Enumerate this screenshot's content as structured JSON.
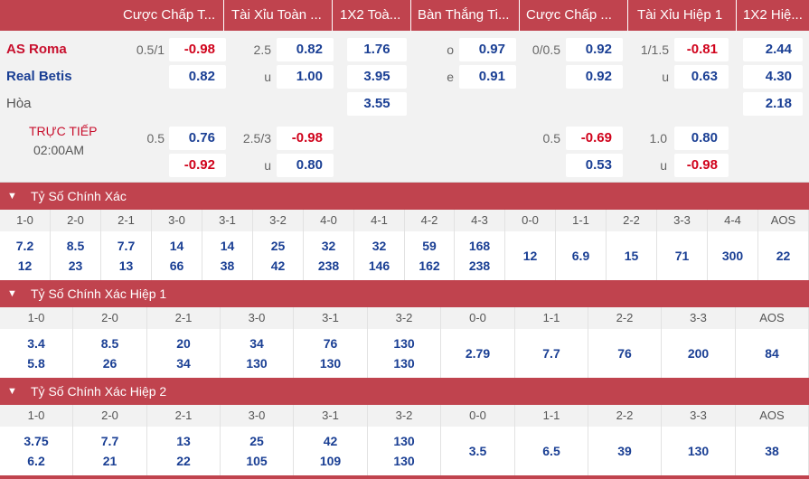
{
  "header": {
    "columns": [
      "Cược Chấp T...",
      "Tài Xỉu Toàn ...",
      "1X2 Toà...",
      "Bàn Thắng Ti...",
      "Cược Chấp ...",
      "Tài Xỉu Hiệp 1",
      "1X2 Hiệ..."
    ]
  },
  "match": {
    "home": "AS Roma",
    "away": "Real Betis",
    "draw": "Hòa",
    "live": "TRỰC TIẾP",
    "time": "02:00AM",
    "r1": {
      "hdp": "0.5/1",
      "hdp_odds": "-0.98",
      "ou_line": "2.5",
      "ou_odds": "0.82",
      "x12": "1.76",
      "goal_lbl": "o",
      "goal_odds": "0.97",
      "h1_hdp": "0/0.5",
      "h1_hdp_odds": "0.92",
      "h1_ou": "1/1.5",
      "h1_ou_odds": "-0.81",
      "h1_x12": "2.44"
    },
    "r2": {
      "hdp_odds": "0.82",
      "ou_lbl": "u",
      "ou_odds": "1.00",
      "x12": "3.95",
      "goal_lbl": "e",
      "goal_odds": "0.91",
      "h1_hdp_odds": "0.92",
      "h1_ou_lbl": "u",
      "h1_ou_odds": "0.63",
      "h1_x12": "4.30"
    },
    "r3": {
      "x12": "3.55",
      "h1_x12": "2.18"
    },
    "r4": {
      "hdp": "0.5",
      "hdp_odds": "0.76",
      "ou_line": "2.5/3",
      "ou_odds": "-0.98",
      "h1_hdp": "0.5",
      "h1_hdp_odds": "-0.69",
      "h1_ou": "1.0",
      "h1_ou_odds": "0.80"
    },
    "r5": {
      "hdp_odds": "-0.92",
      "ou_lbl": "u",
      "ou_odds": "0.80",
      "h1_hdp_odds": "0.53",
      "h1_ou_lbl": "u",
      "h1_ou_odds": "-0.98"
    }
  },
  "sections": [
    {
      "title": "Tỷ Số Chính Xác",
      "scores": [
        "1-0",
        "2-0",
        "2-1",
        "3-0",
        "3-1",
        "3-2",
        "4-0",
        "4-1",
        "4-2",
        "4-3",
        "0-0",
        "1-1",
        "2-2",
        "3-3",
        "4-4",
        "AOS"
      ],
      "top": [
        "7.2",
        "8.5",
        "7.7",
        "14",
        "14",
        "25",
        "32",
        "32",
        "59",
        "168",
        "12",
        "6.9",
        "15",
        "71",
        "300",
        "22"
      ],
      "bottom": [
        "12",
        "23",
        "13",
        "66",
        "38",
        "42",
        "238",
        "146",
        "162",
        "238",
        "",
        "",
        "",
        "",
        "",
        ""
      ]
    },
    {
      "title": "Tỷ Số Chính Xác Hiệp 1",
      "scores": [
        "1-0",
        "2-0",
        "2-1",
        "3-0",
        "3-1",
        "3-2",
        "0-0",
        "1-1",
        "2-2",
        "3-3",
        "AOS"
      ],
      "top": [
        "3.4",
        "8.5",
        "20",
        "34",
        "76",
        "130",
        "2.79",
        "7.7",
        "76",
        "200",
        "84"
      ],
      "bottom": [
        "5.8",
        "26",
        "34",
        "130",
        "130",
        "130",
        "",
        "",
        "",
        "",
        ""
      ]
    },
    {
      "title": "Tỷ Số Chính Xác Hiệp 2",
      "scores": [
        "1-0",
        "2-0",
        "2-1",
        "3-0",
        "3-1",
        "3-2",
        "0-0",
        "1-1",
        "2-2",
        "3-3",
        "AOS"
      ],
      "top": [
        "3.75",
        "7.7",
        "13",
        "25",
        "42",
        "130",
        "3.5",
        "6.5",
        "39",
        "130",
        "38"
      ],
      "bottom": [
        "6.2",
        "21",
        "22",
        "105",
        "109",
        "130",
        "",
        "",
        "",
        "",
        ""
      ]
    }
  ]
}
